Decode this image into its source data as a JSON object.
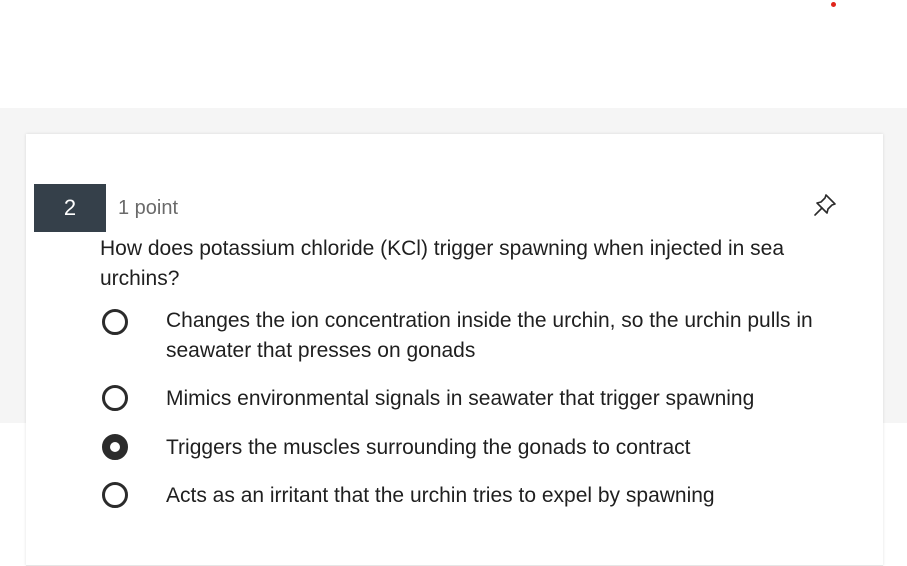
{
  "question": {
    "number": "2",
    "points": "1 point",
    "text": "How does potassium chloride (KCl) trigger spawning when injected in sea urchins?"
  },
  "options": [
    {
      "label": "Changes the ion concentration inside the urchin, so the urchin pulls in seawater that presses on gonads",
      "selected": false
    },
    {
      "label": "Mimics environmental signals in seawater that trigger spawning",
      "selected": false
    },
    {
      "label": "Triggers the muscles surrounding the gonads to contract",
      "selected": true
    },
    {
      "label": "Acts as an irritant that the urchin tries to expel by spawning",
      "selected": false
    }
  ],
  "icons": {
    "pin": "pin-icon",
    "notification_dot": "notification-dot"
  },
  "colors": {
    "number_badge_bg": "#35404a",
    "notification_dot": "#e0241b",
    "radio": "#2b2b2b"
  }
}
